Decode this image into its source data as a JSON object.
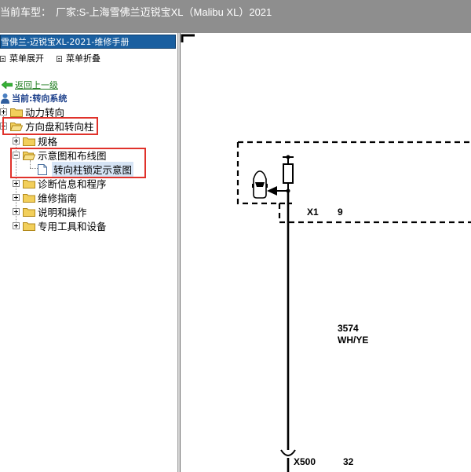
{
  "window": {
    "title_label": "当前车型：",
    "title_value": "厂家:S-上海雪佛兰迈锐宝XL（Malibu XL）2021"
  },
  "manual": {
    "header": "雪佛兰-迈锐宝XL-2021-维修手册",
    "menu_expand": "菜单展开",
    "menu_collapse": "菜单折叠",
    "back_link": "返回上一级",
    "current_system": "当前:转向系统"
  },
  "tree": {
    "power_steering": "动力转向",
    "wheel_and_column": "方向盘和转向柱",
    "specs": "规格",
    "schematics": "示意图和布线图",
    "column_lock_schematic": "转向柱锁定示意图",
    "diagnostics": "诊断信息和程序",
    "repair_guide": "维修指南",
    "description_operation": "说明和操作",
    "special_tools": "专用工具和设备"
  },
  "diagram": {
    "connector_top": "X1",
    "pin_top": "9",
    "circuit_number": "3574",
    "wire_color": "WH/YE",
    "connector_bottom": "X500",
    "pin_bottom": "32"
  },
  "colors": {
    "titlebar": "#8e8e8e",
    "manual_header": "#1a5fa0",
    "highlight_box": "#e0322b",
    "folder": "#f2cf5b"
  }
}
